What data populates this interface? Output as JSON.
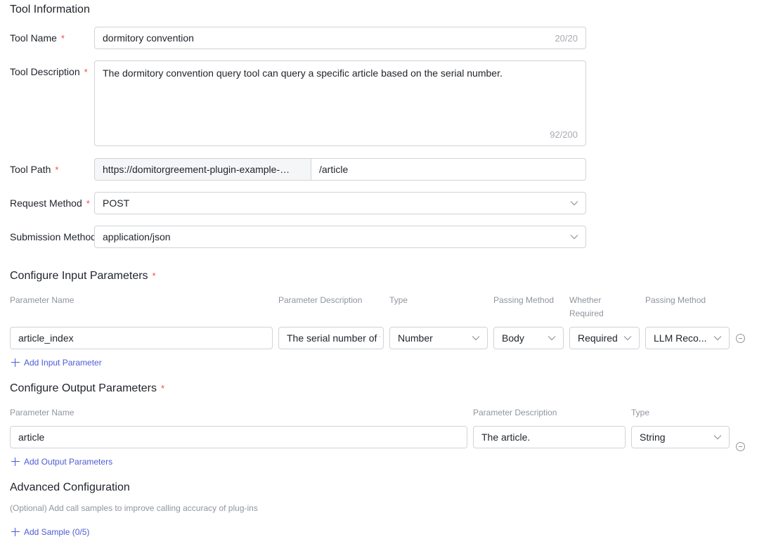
{
  "tool_info": {
    "title": "Tool Information",
    "name_label": "Tool Name",
    "name_value": "dormitory convention",
    "name_counter": "20/20",
    "desc_label": "Tool Description",
    "desc_value": "The dormitory convention query tool can query a specific article based on the serial number.",
    "desc_counter": "92/200",
    "path_label": "Tool Path",
    "path_base": "https://domitorgreement-plugin-example-…",
    "path_value": "/article",
    "method_label": "Request Method",
    "method_value": "POST",
    "submission_label": "Submission Method",
    "submission_value": "application/json"
  },
  "input_params": {
    "title": "Configure Input Parameters",
    "headers": {
      "name": "Parameter Name",
      "description": "Parameter Description",
      "type": "Type",
      "passing": "Passing Method",
      "required_l1": "Whether",
      "required_l2": "Required",
      "passing2": "Passing Method"
    },
    "rows": [
      {
        "name": "article_index",
        "description": "The serial number of the article",
        "type": "Number",
        "passing": "Body",
        "required": "Required",
        "passing2": "LLM Reco..."
      }
    ],
    "add_label": "Add Input Parameter"
  },
  "output_params": {
    "title": "Configure Output Parameters",
    "headers": {
      "name": "Parameter Name",
      "description": "Parameter Description",
      "type": "Type"
    },
    "rows": [
      {
        "name": "article",
        "description": "The article.",
        "type": "String"
      }
    ],
    "add_label": "Add Output Parameters"
  },
  "advanced": {
    "title": "Advanced Configuration",
    "hint": "(Optional) Add call samples to improve calling accuracy of plug-ins",
    "add_label": "Add Sample (0/5)"
  },
  "colors": {
    "accent": "#4e5bd6",
    "required_star": "#f54a45",
    "border": "#d0d3d6"
  }
}
